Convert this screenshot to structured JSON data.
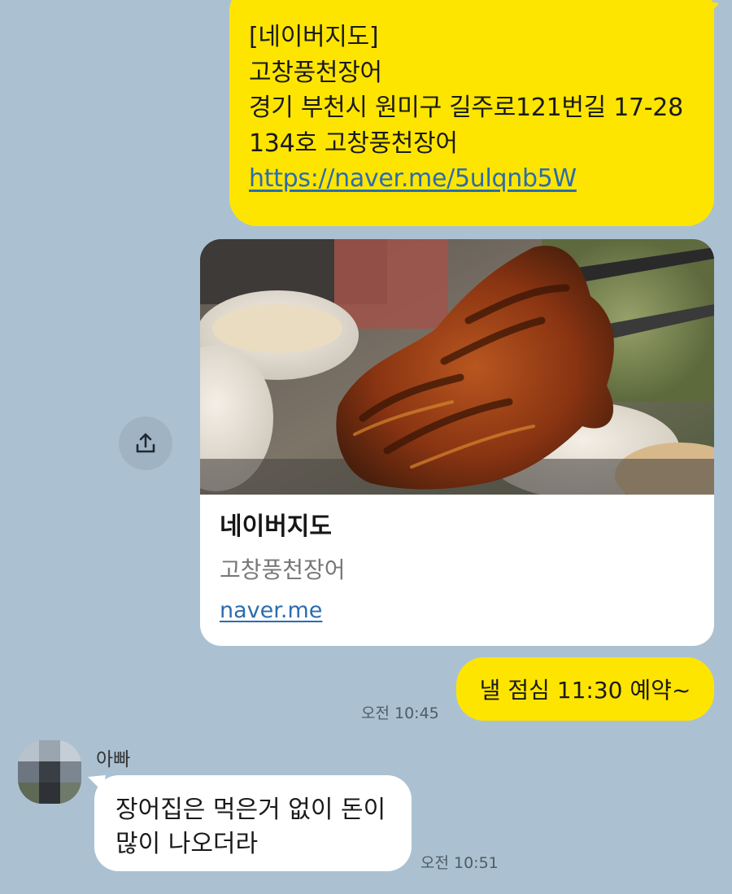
{
  "messages": {
    "address_message": {
      "lines": [
        "[네이버지도]",
        "고창풍천장어",
        "경기 부천시 원미구 길주로121번길 17-28",
        "134호 고창풍천장어"
      ],
      "link": "https://naver.me/5ulqnb5W"
    },
    "link_preview": {
      "title": "네이버지도",
      "description": "고창풍천장어",
      "domain": "naver.me"
    },
    "my_message": {
      "text": "낼 점심 11:30 예약~",
      "time": "오전 10:45"
    },
    "reply_message": {
      "sender": "아빠",
      "lines": [
        "장어집은 먹은거 없이 돈이",
        "많이 나오더라"
      ],
      "time": "오전 10:51"
    }
  },
  "icons": {
    "share": "share-upload-icon"
  },
  "colors": {
    "chat_background": "#abc1d1",
    "my_bubble": "#fee500",
    "other_bubble": "#ffffff",
    "link": "#2b6cb0"
  }
}
